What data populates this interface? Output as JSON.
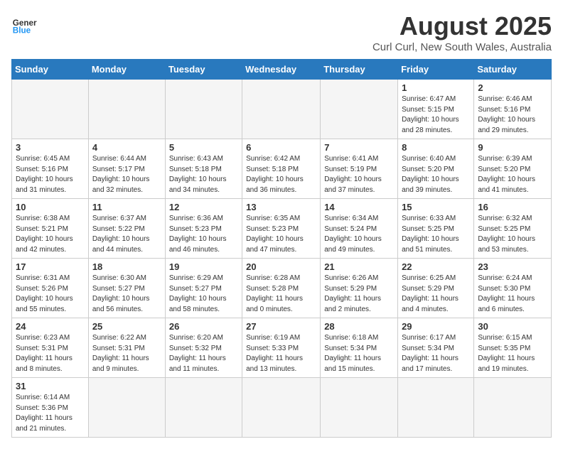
{
  "header": {
    "logo_text_general": "General",
    "logo_text_blue": "Blue",
    "month_title": "August 2025",
    "location": "Curl Curl, New South Wales, Australia"
  },
  "days_of_week": [
    "Sunday",
    "Monday",
    "Tuesday",
    "Wednesday",
    "Thursday",
    "Friday",
    "Saturday"
  ],
  "weeks": [
    [
      {
        "day": "",
        "info": ""
      },
      {
        "day": "",
        "info": ""
      },
      {
        "day": "",
        "info": ""
      },
      {
        "day": "",
        "info": ""
      },
      {
        "day": "",
        "info": ""
      },
      {
        "day": "1",
        "info": "Sunrise: 6:47 AM\nSunset: 5:15 PM\nDaylight: 10 hours and 28 minutes."
      },
      {
        "day": "2",
        "info": "Sunrise: 6:46 AM\nSunset: 5:16 PM\nDaylight: 10 hours and 29 minutes."
      }
    ],
    [
      {
        "day": "3",
        "info": "Sunrise: 6:45 AM\nSunset: 5:16 PM\nDaylight: 10 hours and 31 minutes."
      },
      {
        "day": "4",
        "info": "Sunrise: 6:44 AM\nSunset: 5:17 PM\nDaylight: 10 hours and 32 minutes."
      },
      {
        "day": "5",
        "info": "Sunrise: 6:43 AM\nSunset: 5:18 PM\nDaylight: 10 hours and 34 minutes."
      },
      {
        "day": "6",
        "info": "Sunrise: 6:42 AM\nSunset: 5:18 PM\nDaylight: 10 hours and 36 minutes."
      },
      {
        "day": "7",
        "info": "Sunrise: 6:41 AM\nSunset: 5:19 PM\nDaylight: 10 hours and 37 minutes."
      },
      {
        "day": "8",
        "info": "Sunrise: 6:40 AM\nSunset: 5:20 PM\nDaylight: 10 hours and 39 minutes."
      },
      {
        "day": "9",
        "info": "Sunrise: 6:39 AM\nSunset: 5:20 PM\nDaylight: 10 hours and 41 minutes."
      }
    ],
    [
      {
        "day": "10",
        "info": "Sunrise: 6:38 AM\nSunset: 5:21 PM\nDaylight: 10 hours and 42 minutes."
      },
      {
        "day": "11",
        "info": "Sunrise: 6:37 AM\nSunset: 5:22 PM\nDaylight: 10 hours and 44 minutes."
      },
      {
        "day": "12",
        "info": "Sunrise: 6:36 AM\nSunset: 5:23 PM\nDaylight: 10 hours and 46 minutes."
      },
      {
        "day": "13",
        "info": "Sunrise: 6:35 AM\nSunset: 5:23 PM\nDaylight: 10 hours and 47 minutes."
      },
      {
        "day": "14",
        "info": "Sunrise: 6:34 AM\nSunset: 5:24 PM\nDaylight: 10 hours and 49 minutes."
      },
      {
        "day": "15",
        "info": "Sunrise: 6:33 AM\nSunset: 5:25 PM\nDaylight: 10 hours and 51 minutes."
      },
      {
        "day": "16",
        "info": "Sunrise: 6:32 AM\nSunset: 5:25 PM\nDaylight: 10 hours and 53 minutes."
      }
    ],
    [
      {
        "day": "17",
        "info": "Sunrise: 6:31 AM\nSunset: 5:26 PM\nDaylight: 10 hours and 55 minutes."
      },
      {
        "day": "18",
        "info": "Sunrise: 6:30 AM\nSunset: 5:27 PM\nDaylight: 10 hours and 56 minutes."
      },
      {
        "day": "19",
        "info": "Sunrise: 6:29 AM\nSunset: 5:27 PM\nDaylight: 10 hours and 58 minutes."
      },
      {
        "day": "20",
        "info": "Sunrise: 6:28 AM\nSunset: 5:28 PM\nDaylight: 11 hours and 0 minutes."
      },
      {
        "day": "21",
        "info": "Sunrise: 6:26 AM\nSunset: 5:29 PM\nDaylight: 11 hours and 2 minutes."
      },
      {
        "day": "22",
        "info": "Sunrise: 6:25 AM\nSunset: 5:29 PM\nDaylight: 11 hours and 4 minutes."
      },
      {
        "day": "23",
        "info": "Sunrise: 6:24 AM\nSunset: 5:30 PM\nDaylight: 11 hours and 6 minutes."
      }
    ],
    [
      {
        "day": "24",
        "info": "Sunrise: 6:23 AM\nSunset: 5:31 PM\nDaylight: 11 hours and 8 minutes."
      },
      {
        "day": "25",
        "info": "Sunrise: 6:22 AM\nSunset: 5:31 PM\nDaylight: 11 hours and 9 minutes."
      },
      {
        "day": "26",
        "info": "Sunrise: 6:20 AM\nSunset: 5:32 PM\nDaylight: 11 hours and 11 minutes."
      },
      {
        "day": "27",
        "info": "Sunrise: 6:19 AM\nSunset: 5:33 PM\nDaylight: 11 hours and 13 minutes."
      },
      {
        "day": "28",
        "info": "Sunrise: 6:18 AM\nSunset: 5:34 PM\nDaylight: 11 hours and 15 minutes."
      },
      {
        "day": "29",
        "info": "Sunrise: 6:17 AM\nSunset: 5:34 PM\nDaylight: 11 hours and 17 minutes."
      },
      {
        "day": "30",
        "info": "Sunrise: 6:15 AM\nSunset: 5:35 PM\nDaylight: 11 hours and 19 minutes."
      }
    ],
    [
      {
        "day": "31",
        "info": "Sunrise: 6:14 AM\nSunset: 5:36 PM\nDaylight: 11 hours and 21 minutes."
      },
      {
        "day": "",
        "info": ""
      },
      {
        "day": "",
        "info": ""
      },
      {
        "day": "",
        "info": ""
      },
      {
        "day": "",
        "info": ""
      },
      {
        "day": "",
        "info": ""
      },
      {
        "day": "",
        "info": ""
      }
    ]
  ]
}
